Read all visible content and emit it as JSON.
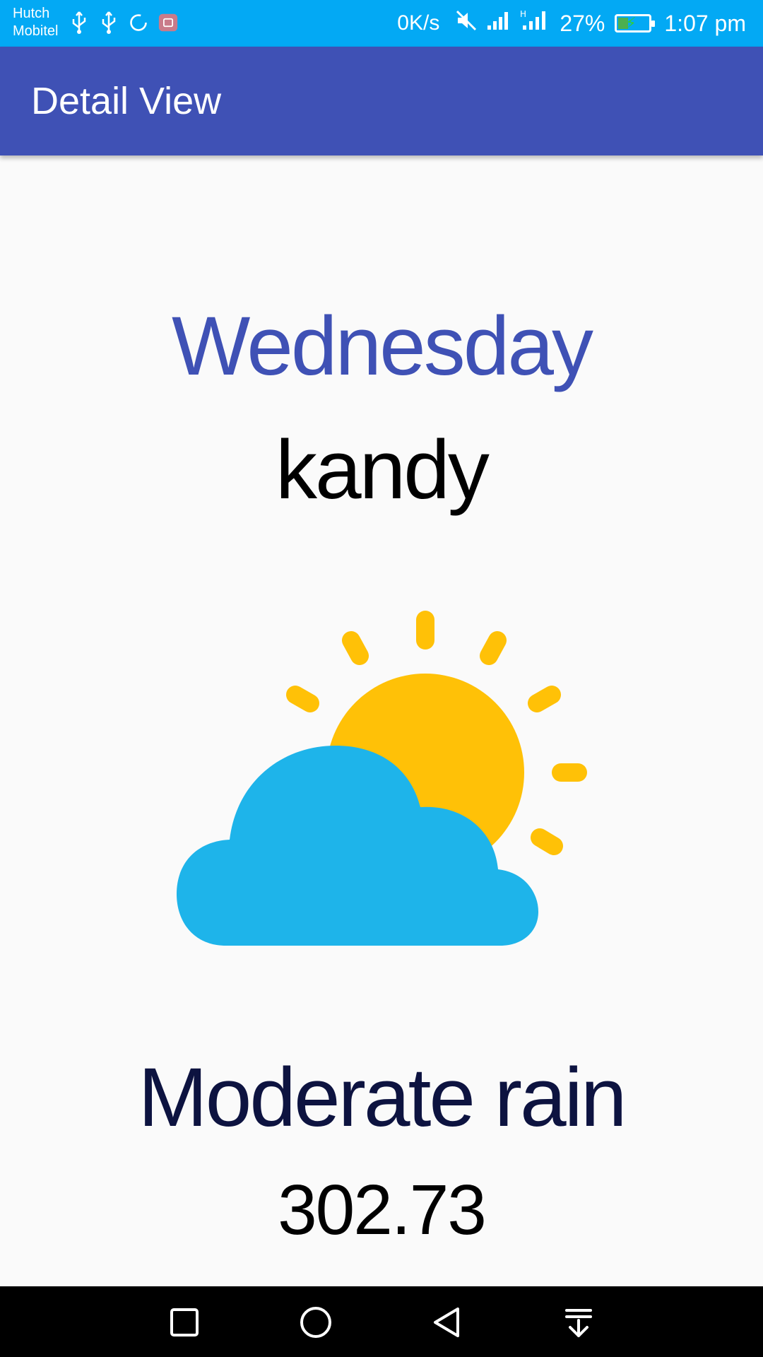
{
  "status_bar": {
    "carrier_line1": "Hutch",
    "carrier_line2": "Mobitel",
    "speed": "0K/s",
    "battery": "27%",
    "time": "1:07 pm",
    "icons": [
      "usb-icon",
      "usb-icon",
      "sync-icon",
      "notification-app-icon",
      "mute-icon",
      "signal-icon",
      "signal-h-icon",
      "battery-charging-icon"
    ]
  },
  "app_bar": {
    "title": "Detail View"
  },
  "detail": {
    "day": "Wednesday",
    "city": "kandy",
    "icon": "partly-cloudy-icon",
    "description": "Moderate rain",
    "temperature": "302.73"
  },
  "nav_bar": {
    "icons": [
      "recents-icon",
      "home-icon",
      "back-icon",
      "notification-pull-icon"
    ]
  },
  "colors": {
    "status_bar": "#03a9f4",
    "app_bar": "#3f51b5",
    "day_text": "#3f51b5",
    "description_text": "#0d1340",
    "sun": "#ffc107",
    "cloud": "#1eb4ea"
  }
}
